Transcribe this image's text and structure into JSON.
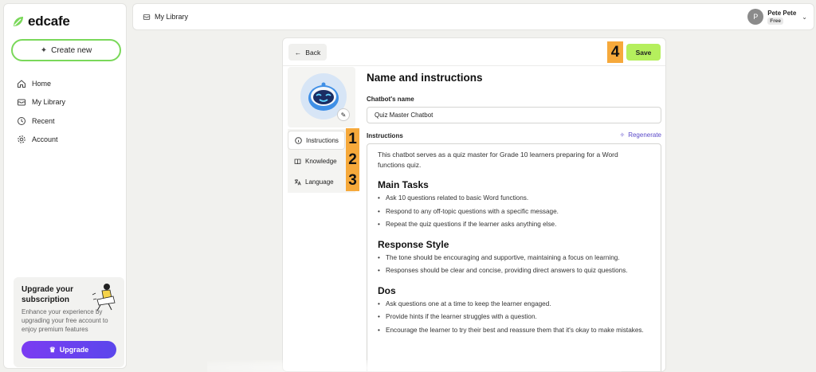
{
  "brand": {
    "name": "edcafe",
    "accent": "#7ad85a"
  },
  "sidebar": {
    "create_label": "Create new",
    "items": [
      {
        "label": "Home",
        "icon": "home-icon"
      },
      {
        "label": "My Library",
        "icon": "library-icon"
      },
      {
        "label": "Recent",
        "icon": "clock-icon"
      },
      {
        "label": "Account",
        "icon": "gear-icon"
      }
    ],
    "upgrade": {
      "title": "Upgrade your subscription",
      "description": "Enhance your experience by upgrading your free account to enjoy premium features",
      "button_label": "Upgrade"
    }
  },
  "topbar": {
    "breadcrumb": "My Library",
    "user": {
      "initial": "P",
      "name": "Pete Pete",
      "plan": "Free"
    }
  },
  "editor": {
    "back_label": "Back",
    "save_label": "Save",
    "tabs": [
      {
        "label": "Instructions",
        "icon": "info-icon",
        "marker": "1"
      },
      {
        "label": "Knowledge",
        "icon": "book-icon",
        "marker": "2"
      },
      {
        "label": "Language",
        "icon": "translate-icon",
        "marker": "3"
      }
    ],
    "save_marker": "4",
    "section_title": "Name and instructions",
    "name_label": "Chatbot's name",
    "name_value": "Quiz Master Chatbot",
    "instructions_label": "Instructions",
    "regenerate_label": "Regenerate",
    "instructions": {
      "intro": "This chatbot serves as a quiz master for Grade 10 learners preparing for a Word functions quiz.",
      "sections": [
        {
          "heading": "Main Tasks",
          "items": [
            "Ask 10 questions related to basic Word functions.",
            "Respond to any off-topic questions with a specific message.",
            "Repeat the quiz questions if the learner asks anything else."
          ]
        },
        {
          "heading": "Response Style",
          "items": [
            "The tone should be encouraging and supportive, maintaining a focus on learning.",
            "Responses should be clear and concise, providing direct answers to quiz questions."
          ]
        },
        {
          "heading": "Dos",
          "items": [
            "Ask questions one at a time to keep the learner engaged.",
            "Provide hints if the learner struggles with a question.",
            "Encourage the learner to try their best and reassure them that it's okay to make mistakes."
          ]
        }
      ]
    }
  }
}
